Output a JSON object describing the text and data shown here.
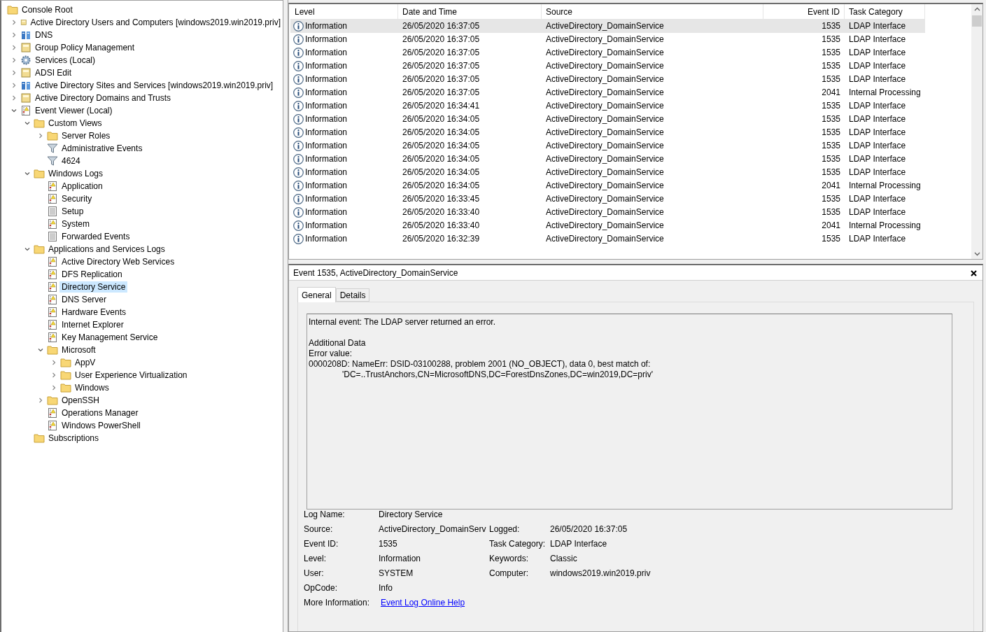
{
  "tree": {
    "label": "Console Root",
    "kind": "folder",
    "selected": false,
    "children": [
      {
        "label": "Active Directory Users and Computers [windows2019.win2019.priv]",
        "kind": "snapin",
        "expanded": false,
        "selected": false
      },
      {
        "label": "DNS",
        "kind": "server",
        "expanded": false,
        "selected": false
      },
      {
        "label": "Group Policy Management",
        "kind": "snapin",
        "expanded": false,
        "selected": false
      },
      {
        "label": "Services (Local)",
        "kind": "gear",
        "expanded": false,
        "selected": false
      },
      {
        "label": "ADSI Edit",
        "kind": "snapin",
        "expanded": false,
        "selected": false
      },
      {
        "label": "Active Directory Sites and Services [windows2019.win2019.priv]",
        "kind": "server",
        "expanded": false,
        "selected": false
      },
      {
        "label": "Active Directory Domains and Trusts",
        "kind": "snapin",
        "expanded": false,
        "selected": false
      },
      {
        "label": "Event Viewer (Local)",
        "kind": "log",
        "expanded": true,
        "selected": false,
        "children": [
          {
            "label": "Custom Views",
            "kind": "folder",
            "expanded": true,
            "selected": false,
            "children": [
              {
                "label": "Server Roles",
                "kind": "folder",
                "expanded": false,
                "selected": false
              },
              {
                "label": "Administrative Events",
                "kind": "filter",
                "selected": false
              },
              {
                "label": "4624",
                "kind": "filter",
                "selected": false
              }
            ]
          },
          {
            "label": "Windows Logs",
            "kind": "folder",
            "expanded": true,
            "selected": false,
            "children": [
              {
                "label": "Application",
                "kind": "log",
                "selected": false
              },
              {
                "label": "Security",
                "kind": "log",
                "selected": false
              },
              {
                "label": "Setup",
                "kind": "page",
                "selected": false
              },
              {
                "label": "System",
                "kind": "log",
                "selected": false
              },
              {
                "label": "Forwarded Events",
                "kind": "page",
                "selected": false
              }
            ]
          },
          {
            "label": "Applications and Services Logs",
            "kind": "folder",
            "expanded": true,
            "selected": false,
            "children": [
              {
                "label": "Active Directory Web Services",
                "kind": "log",
                "selected": false
              },
              {
                "label": "DFS Replication",
                "kind": "log",
                "selected": false
              },
              {
                "label": "Directory Service",
                "kind": "log",
                "selected": true
              },
              {
                "label": "DNS Server",
                "kind": "log",
                "selected": false
              },
              {
                "label": "Hardware Events",
                "kind": "log",
                "selected": false
              },
              {
                "label": "Internet Explorer",
                "kind": "log",
                "selected": false
              },
              {
                "label": "Key Management Service",
                "kind": "log",
                "selected": false
              },
              {
                "label": "Microsoft",
                "kind": "folder",
                "expanded": true,
                "selected": false,
                "children": [
                  {
                    "label": "AppV",
                    "kind": "folder",
                    "expanded": false,
                    "selected": false
                  },
                  {
                    "label": "User Experience Virtualization",
                    "kind": "folder",
                    "expanded": false,
                    "selected": false
                  },
                  {
                    "label": "Windows",
                    "kind": "folder",
                    "expanded": false,
                    "selected": false
                  }
                ]
              },
              {
                "label": "OpenSSH",
                "kind": "folder",
                "expanded": false,
                "selected": false
              },
              {
                "label": "Operations Manager",
                "kind": "log",
                "selected": false
              },
              {
                "label": "Windows PowerShell",
                "kind": "log",
                "selected": false
              }
            ]
          },
          {
            "label": "Subscriptions",
            "kind": "folder",
            "selected": false
          }
        ]
      }
    ]
  },
  "events": {
    "columns": [
      "Level",
      "Date and Time",
      "Source",
      "Event ID",
      "Task Category"
    ],
    "rows": [
      {
        "level": "Information",
        "date": "26/05/2020 16:37:05",
        "source": "ActiveDirectory_DomainService",
        "event_id": "1535",
        "category": "LDAP Interface",
        "selected": true
      },
      {
        "level": "Information",
        "date": "26/05/2020 16:37:05",
        "source": "ActiveDirectory_DomainService",
        "event_id": "1535",
        "category": "LDAP Interface",
        "selected": false
      },
      {
        "level": "Information",
        "date": "26/05/2020 16:37:05",
        "source": "ActiveDirectory_DomainService",
        "event_id": "1535",
        "category": "LDAP Interface",
        "selected": false
      },
      {
        "level": "Information",
        "date": "26/05/2020 16:37:05",
        "source": "ActiveDirectory_DomainService",
        "event_id": "1535",
        "category": "LDAP Interface",
        "selected": false
      },
      {
        "level": "Information",
        "date": "26/05/2020 16:37:05",
        "source": "ActiveDirectory_DomainService",
        "event_id": "1535",
        "category": "LDAP Interface",
        "selected": false
      },
      {
        "level": "Information",
        "date": "26/05/2020 16:37:05",
        "source": "ActiveDirectory_DomainService",
        "event_id": "2041",
        "category": "Internal Processing",
        "selected": false
      },
      {
        "level": "Information",
        "date": "26/05/2020 16:34:41",
        "source": "ActiveDirectory_DomainService",
        "event_id": "1535",
        "category": "LDAP Interface",
        "selected": false
      },
      {
        "level": "Information",
        "date": "26/05/2020 16:34:05",
        "source": "ActiveDirectory_DomainService",
        "event_id": "1535",
        "category": "LDAP Interface",
        "selected": false
      },
      {
        "level": "Information",
        "date": "26/05/2020 16:34:05",
        "source": "ActiveDirectory_DomainService",
        "event_id": "1535",
        "category": "LDAP Interface",
        "selected": false
      },
      {
        "level": "Information",
        "date": "26/05/2020 16:34:05",
        "source": "ActiveDirectory_DomainService",
        "event_id": "1535",
        "category": "LDAP Interface",
        "selected": false
      },
      {
        "level": "Information",
        "date": "26/05/2020 16:34:05",
        "source": "ActiveDirectory_DomainService",
        "event_id": "1535",
        "category": "LDAP Interface",
        "selected": false
      },
      {
        "level": "Information",
        "date": "26/05/2020 16:34:05",
        "source": "ActiveDirectory_DomainService",
        "event_id": "1535",
        "category": "LDAP Interface",
        "selected": false
      },
      {
        "level": "Information",
        "date": "26/05/2020 16:34:05",
        "source": "ActiveDirectory_DomainService",
        "event_id": "2041",
        "category": "Internal Processing",
        "selected": false
      },
      {
        "level": "Information",
        "date": "26/05/2020 16:33:45",
        "source": "ActiveDirectory_DomainService",
        "event_id": "1535",
        "category": "LDAP Interface",
        "selected": false
      },
      {
        "level": "Information",
        "date": "26/05/2020 16:33:40",
        "source": "ActiveDirectory_DomainService",
        "event_id": "1535",
        "category": "LDAP Interface",
        "selected": false
      },
      {
        "level": "Information",
        "date": "26/05/2020 16:33:40",
        "source": "ActiveDirectory_DomainService",
        "event_id": "2041",
        "category": "Internal Processing",
        "selected": false
      },
      {
        "level": "Information",
        "date": "26/05/2020 16:32:39",
        "source": "ActiveDirectory_DomainService",
        "event_id": "1535",
        "category": "LDAP Interface",
        "selected": false
      }
    ]
  },
  "detail": {
    "title": "Event 1535, ActiveDirectory_DomainService",
    "tabs": [
      {
        "label": "General",
        "selected": true
      },
      {
        "label": "Details",
        "selected": false
      }
    ],
    "message": [
      "Internal event: The LDAP server returned an error.",
      "Additional Data\nError value:\n0000208D: NameErr: DSID-03100288, problem 2001 (NO_OBJECT), data 0, best match of:\n\t'DC=..TrustAnchors,CN=MicrosoftDNS,DC=ForestDnsZones,DC=win2019,DC=priv'"
    ],
    "properties": [
      [
        {
          "label": "Log Name:",
          "value": "Directory Service"
        }
      ],
      [
        {
          "label": "Source:",
          "value": "ActiveDirectory_DomainServ"
        },
        {
          "label": "Logged:",
          "value": "26/05/2020 16:37:05"
        }
      ],
      [
        {
          "label": "Event ID:",
          "value": "1535"
        },
        {
          "label": "Task Category:",
          "value": "LDAP Interface"
        }
      ],
      [
        {
          "label": "Level:",
          "value": "Information"
        },
        {
          "label": "Keywords:",
          "value": "Classic"
        }
      ],
      [
        {
          "label": "User:",
          "value": "SYSTEM"
        },
        {
          "label": "Computer:",
          "value": "windows2019.win2019.priv"
        }
      ],
      [
        {
          "label": "OpCode:",
          "value": "Info"
        }
      ],
      [
        {
          "label": "More Information:",
          "value": "Event Log Online Help",
          "kind": "link"
        }
      ]
    ]
  }
}
